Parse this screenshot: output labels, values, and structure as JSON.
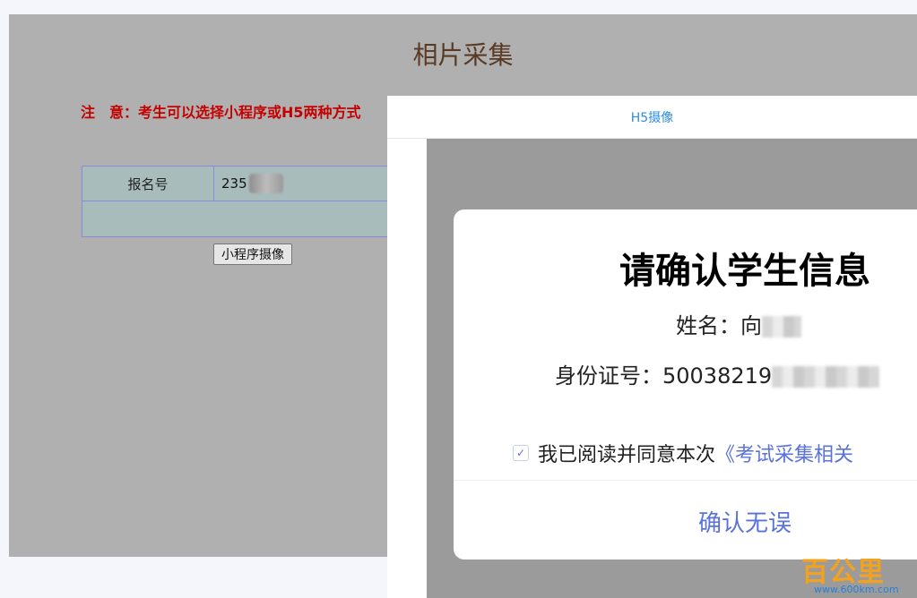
{
  "page": {
    "title": "相片采集",
    "notice": "注　意：考生可以选择小程序或H5两种方式"
  },
  "form": {
    "reg_label": "报名号",
    "reg_value": "235",
    "miniprogram_button": "小程序摄像"
  },
  "h5": {
    "header_title": "H5摄像"
  },
  "dialog": {
    "title": "请确认学生信息",
    "name_label": "姓名：",
    "name_value": "向",
    "id_label": "身份证号：",
    "id_value": "50038219",
    "agree_text": "我已阅读并同意本次",
    "agree_link": "《考试采集相关",
    "confirm_button": "确认无误"
  },
  "watermark": {
    "logo_text": "百公里",
    "url": "www.600km.com"
  },
  "colors": {
    "notice": "#c40000",
    "link": "#5a73d8",
    "header_accent": "#2b8ce8"
  }
}
